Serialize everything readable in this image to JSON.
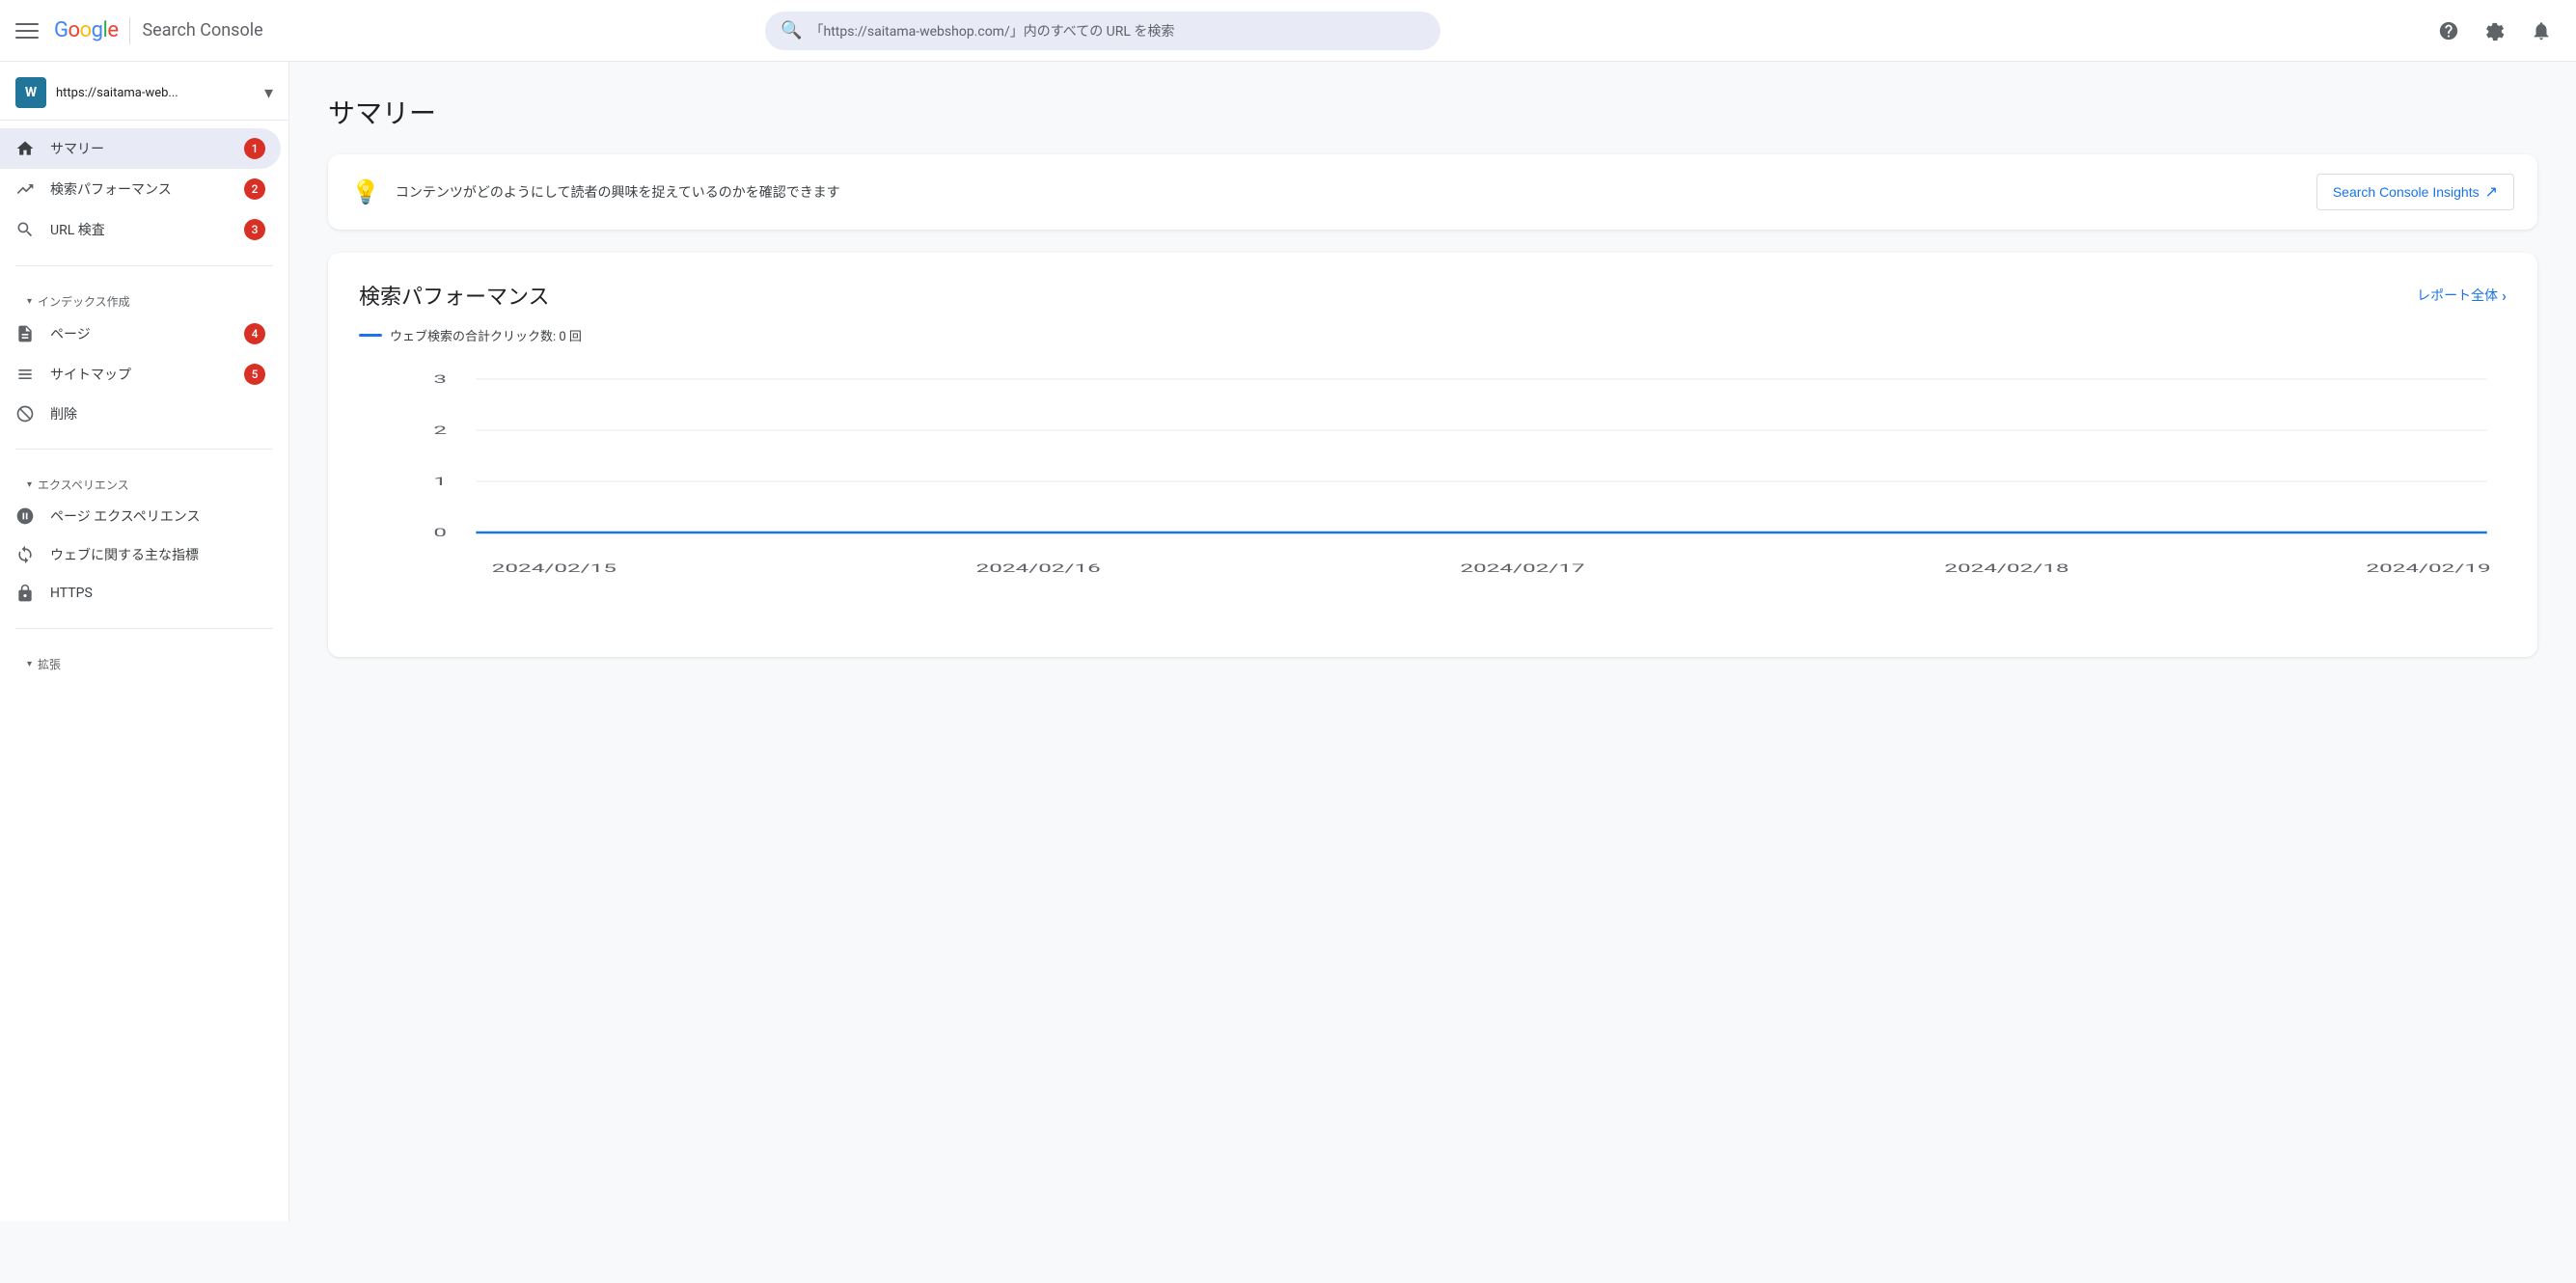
{
  "header": {
    "menu_icon": "☰",
    "logo": {
      "google": "Google",
      "product": "Search Console"
    },
    "search_placeholder": "「https://saitama-webshop.com/」内のすべての URL を検索",
    "help_icon": "?",
    "settings_icon": "⚙",
    "bell_icon": "🔔"
  },
  "sidebar": {
    "property": {
      "url": "https://saitama-web...",
      "full_url": "https://saitama-webshop.com/"
    },
    "nav_items": [
      {
        "id": "summary",
        "label": "サマリー",
        "icon": "home",
        "badge": "1",
        "active": true
      },
      {
        "id": "search-performance",
        "label": "検索パフォーマンス",
        "icon": "trending_up",
        "badge": "2",
        "active": false
      },
      {
        "id": "url-inspection",
        "label": "URL 検査",
        "icon": "search",
        "badge": "3",
        "active": false
      }
    ],
    "index_section": {
      "label": "インデックス作成",
      "items": [
        {
          "id": "pages",
          "label": "ページ",
          "icon": "file",
          "badge": "4"
        },
        {
          "id": "sitemaps",
          "label": "サイトマップ",
          "icon": "sitemap",
          "badge": "5"
        },
        {
          "id": "removals",
          "label": "削除",
          "icon": "remove_circle",
          "badge": null
        }
      ]
    },
    "experience_section": {
      "label": "エクスペリエンス",
      "items": [
        {
          "id": "page-experience",
          "label": "ページ エクスペリエンス",
          "icon": "speed",
          "badge": null
        },
        {
          "id": "core-web-vitals",
          "label": "ウェブに関する主な指標",
          "icon": "refresh",
          "badge": null
        },
        {
          "id": "https",
          "label": "HTTPS",
          "icon": "lock",
          "badge": null
        }
      ]
    },
    "expansion_section": {
      "label": "拡張"
    }
  },
  "main": {
    "page_title": "サマリー",
    "insight_banner": {
      "text": "コンテンツがどのようにして読者の興味を捉えているのかを確認できます",
      "link_label": "Search Console Insights",
      "link_icon": "↗"
    },
    "performance_card": {
      "title": "検索パフォーマンス",
      "report_link": "レポート全体",
      "legend_text": "ウェブ検索の合計クリック数: 0 回",
      "chart": {
        "y_labels": [
          "3",
          "2",
          "1",
          "0"
        ],
        "x_labels": [
          "2024/02/15",
          "2024/02/16",
          "2024/02/17",
          "2024/02/18",
          "2024/02/19"
        ],
        "y_max": 3,
        "data_line_color": "#1a73e8"
      }
    }
  }
}
